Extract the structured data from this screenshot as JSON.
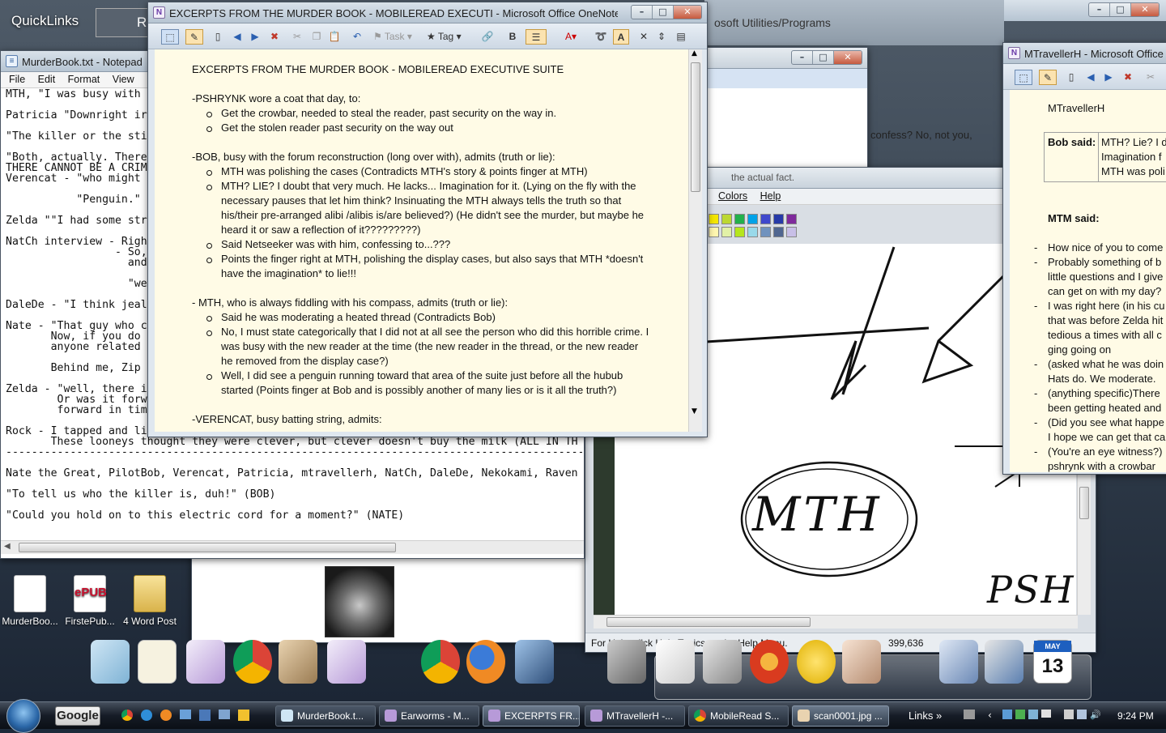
{
  "desktop": {
    "quicklinks_label": "QuickLinks",
    "bg_partial_label": "Re",
    "bg_window_partial": "osoft Utilities/Programs",
    "icons": [
      {
        "label": "MurderBoo..."
      },
      {
        "label": "FirstePub...",
        "badge": "ePUB"
      },
      {
        "label": "4 Word Post"
      }
    ]
  },
  "notepad": {
    "title": "MurderBook.txt - Notepad",
    "menu": [
      "File",
      "Edit",
      "Format",
      "View",
      "He"
    ],
    "lines": [
      "MTH, \"I was busy with",
      "Patricia \"Downright ir",
      "\"The killer or the sti",
      "\"Both, actually. There",
      "THERE CANNOT BE A CRIM",
      "Verencat - \"who might",
      "           \"Penguin.\"",
      "Zelda \"\"I had some str",
      "NatCh interview - Righ",
      "                 - So,",
      "                   and",
      "                   \"well",
      "DaleDe - \"I think jeal",
      "Nate - \"That guy who c",
      "       Now, if you do",
      "       anyone related",
      "       Behind me, Zip",
      "Zelda - \"well, there i",
      "        Or was it forw",
      "        forward in tim",
      "Rock - I tapped and li",
      "       These looneys thought they were clever, but clever doesn't buy the milk (ALL IN TH",
      "-------------------------------------------------------------------------------------------",
      "Nate the Great, PilotBob, Verencat, Patricia, mtravellerh, NatCh, DaleDe, Nekokami, Raven",
      "\"To tell us who the killer is, duh!\" (BOB)",
      "\"Could you hold on to this electric cord for a moment?\" (NATE)"
    ]
  },
  "onenote_main": {
    "title": "EXCERPTS FROM THE MURDER BOOK - MOBILEREAD EXECUTI - Microsoft Office OneNote non-comme...",
    "toolbar": {
      "task": "Task",
      "tag": "Tag"
    },
    "heading": "EXCERPTS FROM THE MURDER  BOOK - MOBILEREAD EXECUTIVE SUITE",
    "sections": [
      {
        "lead": "-PSHRYNK wore a coat that day,  to:",
        "bullets": [
          [
            "Get the crowbar, needed to steal the reader, past security on the way in."
          ],
          [
            "Get the stolen reader past security on the way out"
          ]
        ]
      },
      {
        "lead": "-BOB, busy with the forum reconstruction (long over with), admits (truth or lie):",
        "bullets": [
          [
            "MTH was polishing the cases (Contradicts MTH's story & points finger at MTH)"
          ],
          [
            "MTH? LIE? I doubt that very  much. He lacks... Imagination for it.  (Lying on the fly with the",
            "necessary pauses that let him think? Insinuating the MTH always tells the truth so that",
            "his/their pre-arranged alibi /alibis is/are believed?) (He didn't see the murder, but maybe he",
            "heard it or saw a  reflection of it?????????)"
          ],
          [
            "Said Netseeker was with him, confessing to...???"
          ],
          [
            "Points the finger right at MTH, polishing the display cases, but also says that MTH *doesn't",
            "have the imagination* to lie!!!"
          ]
        ]
      },
      {
        "lead": " - MTH,  who is always fiddling with his compass, admits (truth or lie):",
        "bullets": [
          [
            "Said he was moderating a heated thread (Contradicts Bob)"
          ],
          [
            "No, I must state categorically that I did not at all see the person who did this horrible crime. I",
            "was busy with the new reader at the time (the new reader in the thread, or the new reader",
            "he removed from the display case?)"
          ],
          [
            "Well, I did see a penguin running toward that area of the suite just before all the hubub",
            "started (Points finger at Bob and is possibly another of many lies or is it all the truth?)"
          ]
        ]
      },
      {
        "lead": "-VERENCAT, busy batting string, admits:",
        "bullets": []
      }
    ]
  },
  "behind_window": {
    "partial_text": "confess? No, not you,",
    "partial_text2": "the actual fact."
  },
  "paint": {
    "menu": [
      "Colors",
      "Help"
    ],
    "palette": [
      "#f5e700",
      "#bcd832",
      "#22b14c",
      "#00a2e8",
      "#3f48cc",
      "#263aa8",
      "#7f2a9c",
      "#fff7b0",
      "#e2f1a7",
      "#b5e61d",
      "#99d9ea",
      "#7092be",
      "#506690",
      "#c8bfe7"
    ],
    "drawing_text": "MTH",
    "partial_text": "PSH",
    "status": "For Help, click Help Topics on the Help Menu.",
    "coords": "399,636"
  },
  "onenote_right": {
    "title": "MTravellerH - Microsoft Office O",
    "heading": "MTravellerH",
    "table_label": "Bob said:",
    "table_lines": [
      "MTH? Lie? I d",
      "Imagination f",
      "MTH was poli"
    ],
    "mtm_said": "MTM said:",
    "items": [
      [
        "How nice of you to come"
      ],
      [
        "Probably  something of b",
        "little questions and I give",
        "can get on with my day?"
      ],
      [
        "I was right here (in his cu",
        "that was before Zelda hit",
        "tedious a times with all c",
        "ging going on"
      ],
      [
        "(asked what he was doin",
        "Hats do. We moderate."
      ],
      [
        "(anything specific)There",
        "been getting heated and"
      ],
      [
        "(Did you see what happe",
        "I hope we can get that ca"
      ],
      [
        "(You're an eye witness?)",
        "pshrynk with a crowbar"
      ]
    ]
  },
  "taskbar": {
    "search": "Google",
    "buttons": [
      "MurderBook.t...",
      "Earworms - M...",
      "EXCERPTS FR...",
      "MTravellerH -...",
      "MobileRead S...",
      "scan0001.jpg ..."
    ],
    "links": "Links",
    "clock": "9:24 PM"
  },
  "dock": {
    "calendar_month": "MAY",
    "calendar_day": "13"
  }
}
